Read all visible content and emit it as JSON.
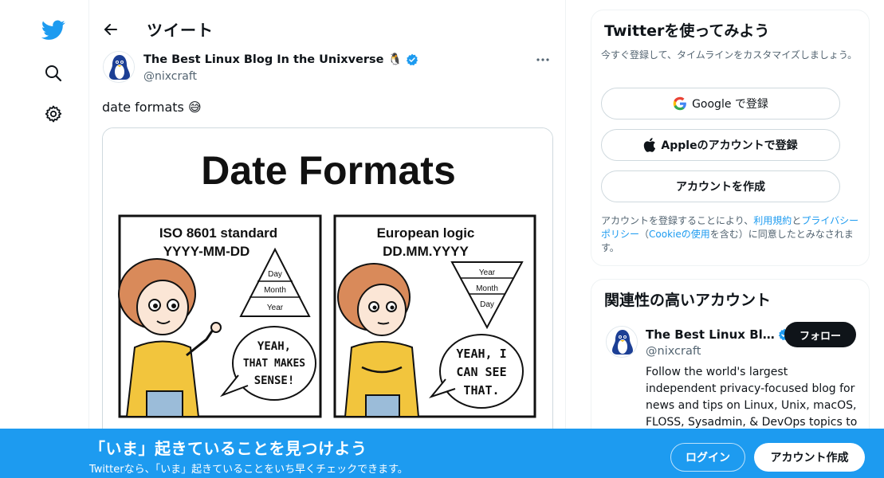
{
  "colors": {
    "brand": "#1d9bf0",
    "text": "#0f1419",
    "muted": "#536471",
    "border": "#cfd9de"
  },
  "nav": {
    "items": [
      {
        "icon": "twitter-logo-icon"
      },
      {
        "icon": "search-icon"
      },
      {
        "icon": "settings-icon"
      }
    ]
  },
  "header": {
    "title": "ツイート"
  },
  "tweet": {
    "author_name": "The Best Linux Blog In the Unixverse 🐧",
    "author_handle": "@nixcraft",
    "text": "date formats 😅",
    "image": {
      "title": "Date Formats",
      "panel_left": {
        "heading": "ISO 8601 standard",
        "format": "YYYY-MM-DD",
        "pyramid": [
          "Day",
          "Month",
          "Year"
        ],
        "speech": [
          "YEAH,",
          "THAT MAKES",
          "SENSE!"
        ]
      },
      "panel_right": {
        "heading": "European logic",
        "format": "DD.MM.YYYY",
        "pyramid": [
          "Year",
          "Month",
          "Day"
        ],
        "speech": [
          "YEAH, I",
          "CAN SEE",
          "THAT."
        ]
      }
    }
  },
  "signup": {
    "title": "Twitterを使ってみよう",
    "subtitle": "今すぐ登録して、タイムラインをカスタマイズしましょう。",
    "google_label": "Google で登録",
    "apple_label": "Appleのアカウントで登録",
    "create_label": "アカウントを作成",
    "legal_pre": "アカウントを登録することにより、",
    "legal_terms": "利用規約",
    "legal_and": "と",
    "legal_privacy": "プライバシーポリシー",
    "legal_paren_open": "（",
    "legal_cookie": "Cookieの使用",
    "legal_post": "を含む）に同意したとみなされます。"
  },
  "related": {
    "title": "関連性の高いアカウント",
    "name": "The Best Linux Bl…",
    "handle": "@nixcraft",
    "follow_label": "フォロー",
    "bio": "Follow the world's largest independent privacy-focused blog for news and tips on Linux, Unix, macOS, FLOSS, Sysadmin, & DevOps topics to"
  },
  "banner": {
    "title": "「いま」起きていることを見つけよう",
    "subtitle": "Twitterなら、「いま」起きていることをいち早くチェックできます。",
    "login_label": "ログイン",
    "create_label": "アカウント作成"
  }
}
